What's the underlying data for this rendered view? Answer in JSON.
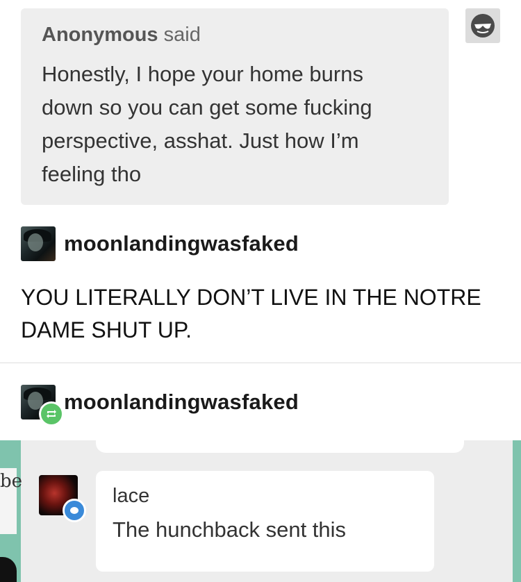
{
  "ask": {
    "asker": "Anonymous",
    "said": "said",
    "text": "Honestly, I hope your home burns down so you can get some fucking perspective, asshat. Just how I’m feeling tho",
    "avatar_icon": "sunglasses-face-icon"
  },
  "answer": {
    "username": "moonlandingwasfaked",
    "text": "YOU LITERALLY DON’T LIVE IN THE NOTRE DAME SHUT UP."
  },
  "reblog": {
    "username": "moonlandingwasfaked",
    "badge_icon": "reblog-icon"
  },
  "embedded_screenshot": {
    "edge_text": "be",
    "sender": "lace",
    "message": "The hunchback sent this",
    "badge_icon": "message-bubble-icon"
  },
  "colors": {
    "ask_background": "#eeeeee",
    "reblog_badge": "#5ac467",
    "message_badge": "#3a8ad9",
    "embedded_edge": "#7fc3ad"
  }
}
